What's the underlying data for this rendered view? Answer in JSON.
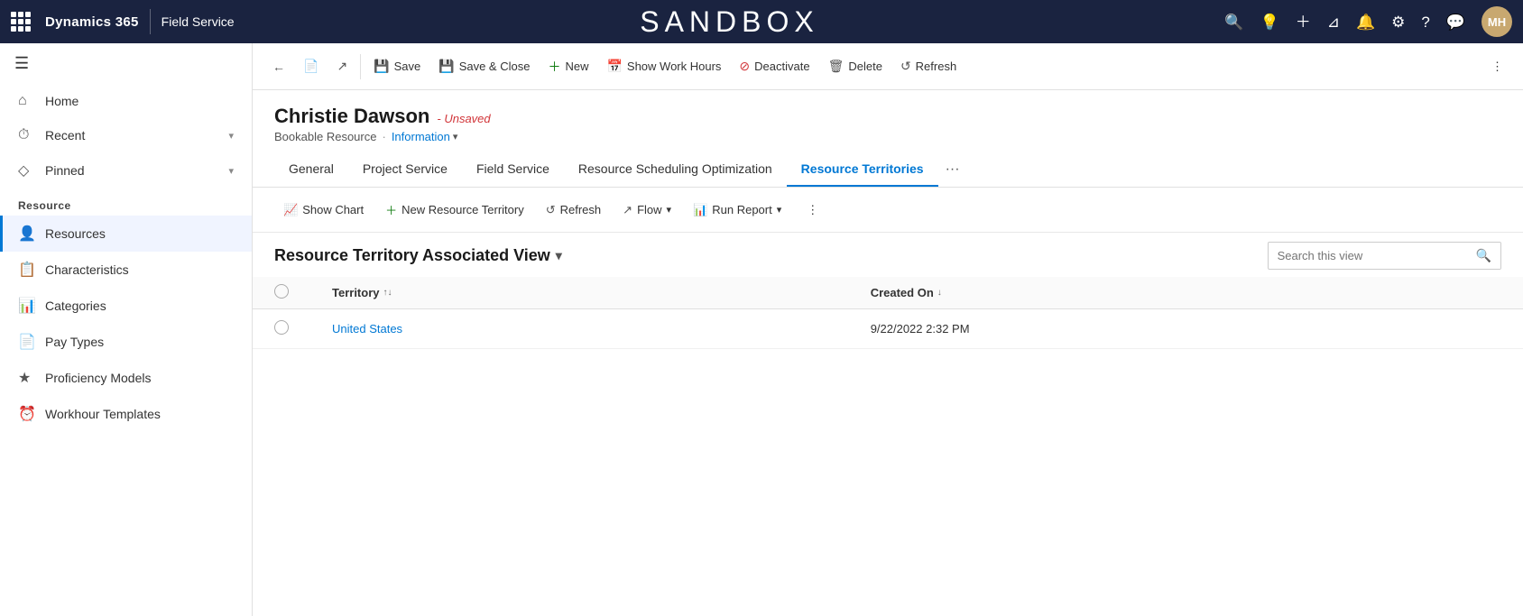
{
  "topNav": {
    "brand": "Dynamics 365",
    "module": "Field Service",
    "sandboxTitle": "SANDBOX",
    "avatar": "MH",
    "icons": [
      "search",
      "lightbulb",
      "plus",
      "filter",
      "bell",
      "settings",
      "help",
      "chat"
    ]
  },
  "sidebar": {
    "items": [
      {
        "id": "home",
        "label": "Home",
        "icon": "⌂"
      },
      {
        "id": "recent",
        "label": "Recent",
        "icon": "⏱",
        "hasChevron": true
      },
      {
        "id": "pinned",
        "label": "Pinned",
        "icon": "◇",
        "hasChevron": true
      }
    ],
    "section": "Resource",
    "resourceItems": [
      {
        "id": "resources",
        "label": "Resources",
        "icon": "👤",
        "active": true
      },
      {
        "id": "characteristics",
        "label": "Characteristics",
        "icon": "📋"
      },
      {
        "id": "categories",
        "label": "Categories",
        "icon": "📊"
      },
      {
        "id": "pay-types",
        "label": "Pay Types",
        "icon": "📄"
      },
      {
        "id": "proficiency-models",
        "label": "Proficiency Models",
        "icon": "★"
      },
      {
        "id": "workhour-templates",
        "label": "Workhour Templates",
        "icon": "⏰"
      }
    ]
  },
  "toolbar": {
    "back_label": "←",
    "copy_label": "Copy",
    "open_label": "Open",
    "save_label": "Save",
    "save_close_label": "Save & Close",
    "new_label": "New",
    "show_work_hours_label": "Show Work Hours",
    "deactivate_label": "Deactivate",
    "delete_label": "Delete",
    "refresh_label": "Refresh"
  },
  "record": {
    "name": "Christie Dawson",
    "status": "Unsaved",
    "type": "Bookable Resource",
    "view": "Information"
  },
  "tabs": [
    {
      "id": "general",
      "label": "General",
      "active": false
    },
    {
      "id": "project-service",
      "label": "Project Service",
      "active": false
    },
    {
      "id": "field-service",
      "label": "Field Service",
      "active": false
    },
    {
      "id": "resource-scheduling-optimization",
      "label": "Resource Scheduling Optimization",
      "active": false
    },
    {
      "id": "resource-territories",
      "label": "Resource Territories",
      "active": true
    }
  ],
  "subgridToolbar": {
    "show_chart_label": "Show Chart",
    "new_resource_territory_label": "New Resource Territory",
    "refresh_label": "Refresh",
    "flow_label": "Flow",
    "run_report_label": "Run Report"
  },
  "subgrid": {
    "title": "Resource Territory Associated View",
    "search_placeholder": "Search this view",
    "columns": [
      {
        "id": "territory",
        "label": "Territory",
        "sortable": true
      },
      {
        "id": "created-on",
        "label": "Created On",
        "sortable": true
      }
    ],
    "rows": [
      {
        "territory": "United States",
        "created_on": "9/22/2022 2:32 PM"
      }
    ]
  }
}
